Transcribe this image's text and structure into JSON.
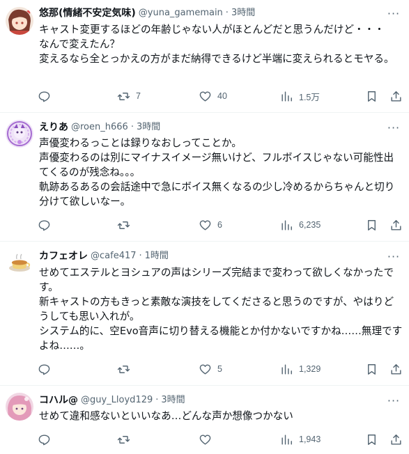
{
  "tweets": [
    {
      "name": "悠那(情緒不安定気味)",
      "handle": "@yuna_gamemain",
      "dot": "·",
      "time": "3時間",
      "lines": [
        "キャスト変更するほどの年齢じゃない人がほとんどだと思うんだけど・・・",
        "なんで変えたん？",
        "変えるなら全とっかえの方がまだ納得できるけど半端に変えられるとモヤる。"
      ],
      "replies": "",
      "retweets": "7",
      "likes": "40",
      "views": "1.5万"
    },
    {
      "name": "えりあ",
      "handle": "@roen_h666",
      "dot": "·",
      "time": "3時間",
      "lines": [
        "声優変わるっことは録りなおしってことか。",
        "声優変わるのは別にマイナスイメージ無いけど、フルボイスじゃない可能性出てくるのが残念ね。。。",
        "軌跡あるあるの会話途中で急にボイス無くなるの少し冷めるからちゃんと切り分けて欲しいなー。"
      ],
      "replies": "",
      "retweets": "",
      "likes": "6",
      "views": "6,235"
    },
    {
      "name": "カフェオレ",
      "handle": "@cafe417",
      "dot": "·",
      "time": "1時間",
      "lines": [
        "せめてエステルとヨシュアの声はシリーズ完結まで変わって欲しくなかったです。",
        "新キャストの方もきっと素敵な演技をしてくださると思うのですが、やはりどうしても思い入れが。",
        "システム的に、空Evo音声に切り替える機能とか付かないですかね……無理ですよね……。"
      ],
      "replies": "",
      "retweets": "",
      "likes": "5",
      "views": "1,329"
    },
    {
      "name": "コハル@",
      "handle": "@guy_Lloyd129",
      "dot": "·",
      "time": "3時間",
      "lines": [
        "せめて違和感ないといいなあ…どんな声か想像つかない"
      ],
      "replies": "",
      "retweets": "",
      "likes": "",
      "views": "1,943"
    }
  ],
  "more_label": "···",
  "colors": {
    "text": "#0f1419",
    "secondary": "#536471",
    "divider": "#eff3f4"
  },
  "icons": {
    "reply": "reply-icon",
    "retweet": "retweet-icon",
    "like": "heart-icon",
    "views": "views-icon",
    "bookmark": "bookmark-icon",
    "share": "share-icon",
    "more": "more-icon"
  }
}
